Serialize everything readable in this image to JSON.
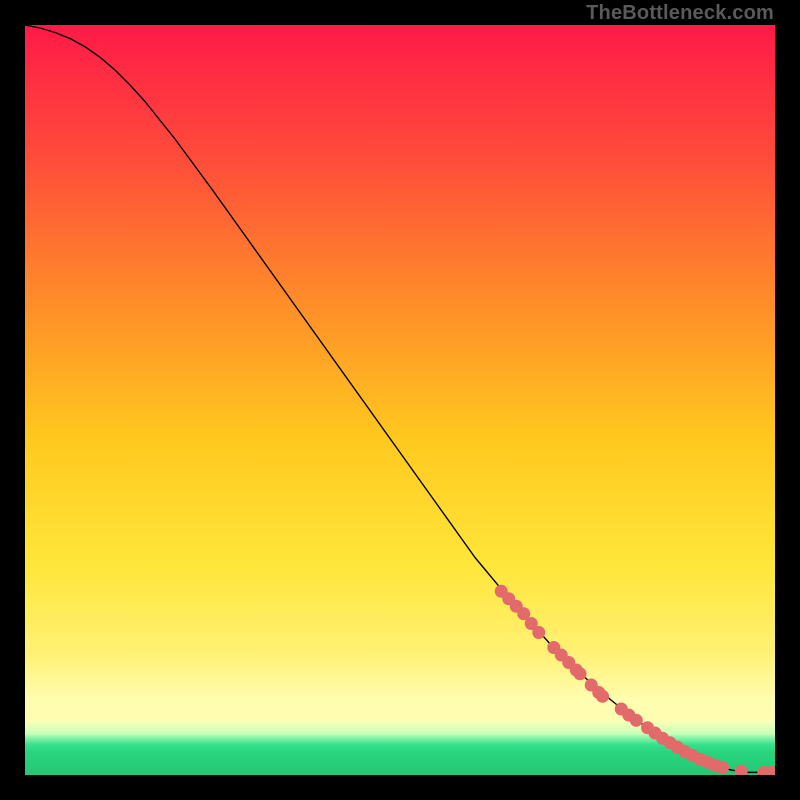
{
  "watermark": "TheBottleneck.com",
  "chart_data": {
    "type": "line",
    "title": "",
    "xlabel": "",
    "ylabel": "",
    "xlim": [
      0,
      100
    ],
    "ylim": [
      0,
      100
    ],
    "grid": false,
    "legend": false,
    "background_gradient": {
      "top": "#ff1a48",
      "upper_mid": "#ff7a2a",
      "mid": "#ffd600",
      "lower_mid": "#fff176",
      "band_soft_yellow": "#fff9b0",
      "band_lighter": "#f6ffb8",
      "band_green": "#2ee68e",
      "bottom_band": "#28d17f"
    },
    "series": [
      {
        "name": "curve",
        "color": "#000000",
        "width": 1.4,
        "x": [
          0,
          2,
          4,
          6,
          8,
          10,
          12,
          14,
          16,
          20,
          25,
          30,
          35,
          40,
          45,
          50,
          55,
          60,
          65,
          70,
          72,
          74,
          76,
          78,
          80,
          82,
          84,
          86,
          88,
          90,
          92,
          94,
          96,
          98,
          100
        ],
        "y": [
          100,
          99.6,
          99.0,
          98.2,
          97.1,
          95.7,
          94.0,
          92.0,
          89.8,
          84.8,
          78.0,
          71.0,
          64.0,
          57.0,
          50.0,
          43.0,
          36.0,
          29.0,
          23.0,
          17.5,
          15.5,
          13.6,
          11.8,
          10.1,
          8.5,
          7.0,
          5.6,
          4.3,
          3.1,
          2.1,
          1.3,
          0.7,
          0.35,
          0.35,
          0.35
        ]
      }
    ],
    "markers": {
      "color": "#e26a6a",
      "radius": 6.5,
      "points": [
        {
          "x": 63.5,
          "y": 24.5
        },
        {
          "x": 64.5,
          "y": 23.5
        },
        {
          "x": 65.5,
          "y": 22.5
        },
        {
          "x": 66.5,
          "y": 21.5
        },
        {
          "x": 67.5,
          "y": 20.2
        },
        {
          "x": 68.5,
          "y": 19.0
        },
        {
          "x": 70.5,
          "y": 17.0
        },
        {
          "x": 71.5,
          "y": 16.0
        },
        {
          "x": 72.5,
          "y": 15.0
        },
        {
          "x": 73.5,
          "y": 14.0
        },
        {
          "x": 74.0,
          "y": 13.5
        },
        {
          "x": 75.5,
          "y": 12.0
        },
        {
          "x": 76.5,
          "y": 11.0
        },
        {
          "x": 77.0,
          "y": 10.5
        },
        {
          "x": 79.5,
          "y": 8.8
        },
        {
          "x": 80.5,
          "y": 8.0
        },
        {
          "x": 81.5,
          "y": 7.3
        },
        {
          "x": 83.0,
          "y": 6.3
        },
        {
          "x": 84.0,
          "y": 5.6
        },
        {
          "x": 85.0,
          "y": 4.9
        },
        {
          "x": 86.0,
          "y": 4.3
        },
        {
          "x": 87.0,
          "y": 3.7
        },
        {
          "x": 88.0,
          "y": 3.1
        },
        {
          "x": 89.0,
          "y": 2.6
        },
        {
          "x": 90.0,
          "y": 2.1
        },
        {
          "x": 91.0,
          "y": 1.7
        },
        {
          "x": 92.0,
          "y": 1.3
        },
        {
          "x": 93.0,
          "y": 1.0
        },
        {
          "x": 95.5,
          "y": 0.5
        },
        {
          "x": 98.5,
          "y": 0.35
        },
        {
          "x": 99.5,
          "y": 0.35
        }
      ]
    }
  }
}
